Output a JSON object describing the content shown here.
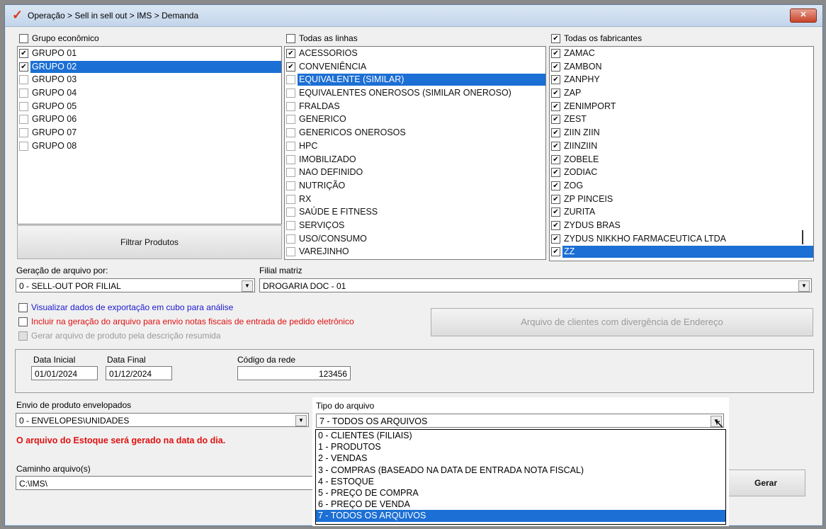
{
  "window": {
    "title": "Operação > Sell in sell out > IMS > Demanda",
    "close_label": "✕"
  },
  "grupo": {
    "header": "Grupo econômico",
    "header_checked": false,
    "items": [
      {
        "label": "GRUPO 01",
        "checked": true,
        "selected": false
      },
      {
        "label": "GRUPO 02",
        "checked": true,
        "selected": true
      },
      {
        "label": "GRUPO 03",
        "checked": false,
        "selected": false
      },
      {
        "label": "GRUPO 04",
        "checked": false,
        "selected": false
      },
      {
        "label": "GRUPO 05",
        "checked": false,
        "selected": false
      },
      {
        "label": "GRUPO 06",
        "checked": false,
        "selected": false
      },
      {
        "label": "GRUPO 07",
        "checked": false,
        "selected": false
      },
      {
        "label": "GRUPO 08",
        "checked": false,
        "selected": false
      }
    ],
    "filter_button": "Filtrar Produtos"
  },
  "linhas": {
    "header": "Todas as linhas",
    "header_checked": false,
    "items": [
      {
        "label": "ACESSORIOS",
        "checked": true,
        "selected": false
      },
      {
        "label": "CONVENIÊNCIA",
        "checked": true,
        "selected": false
      },
      {
        "label": "EQUIVALENTE (SIMILAR)",
        "checked": false,
        "selected": true
      },
      {
        "label": "EQUIVALENTES ONEROSOS (SIMILAR ONEROSO)",
        "checked": false,
        "selected": false
      },
      {
        "label": "FRALDAS",
        "checked": false,
        "selected": false
      },
      {
        "label": "GENERICO",
        "checked": false,
        "selected": false
      },
      {
        "label": "GENERICOS ONEROSOS",
        "checked": false,
        "selected": false
      },
      {
        "label": "HPC",
        "checked": false,
        "selected": false
      },
      {
        "label": "IMOBILIZADO",
        "checked": false,
        "selected": false
      },
      {
        "label": "NAO DEFINIDO",
        "checked": false,
        "selected": false
      },
      {
        "label": "NUTRIÇÃO",
        "checked": false,
        "selected": false
      },
      {
        "label": "RX",
        "checked": false,
        "selected": false
      },
      {
        "label": "SAÚDE E FITNESS",
        "checked": false,
        "selected": false
      },
      {
        "label": "SERVIÇOS",
        "checked": false,
        "selected": false
      },
      {
        "label": "USO/CONSUMO",
        "checked": false,
        "selected": false
      },
      {
        "label": "VAREJINHO",
        "checked": false,
        "selected": false
      }
    ]
  },
  "fabricantes": {
    "header": "Todas os fabricantes",
    "header_checked": true,
    "items": [
      {
        "label": "ZAMAC",
        "checked": true,
        "selected": false
      },
      {
        "label": "ZAMBON",
        "checked": true,
        "selected": false
      },
      {
        "label": "ZANPHY",
        "checked": true,
        "selected": false
      },
      {
        "label": "ZAP",
        "checked": true,
        "selected": false
      },
      {
        "label": "ZENIMPORT",
        "checked": true,
        "selected": false
      },
      {
        "label": "ZEST",
        "checked": true,
        "selected": false
      },
      {
        "label": "ZIIN ZIIN",
        "checked": true,
        "selected": false
      },
      {
        "label": "ZIINZIIN",
        "checked": true,
        "selected": false
      },
      {
        "label": "ZOBELE",
        "checked": true,
        "selected": false
      },
      {
        "label": "ZODIAC",
        "checked": true,
        "selected": false
      },
      {
        "label": "ZOG",
        "checked": true,
        "selected": false
      },
      {
        "label": "ZP PINCEIS",
        "checked": true,
        "selected": false
      },
      {
        "label": "ZURITA",
        "checked": true,
        "selected": false
      },
      {
        "label": "ZYDUS BRAS",
        "checked": true,
        "selected": false
      },
      {
        "label": "ZYDUS NIKKHO FARMACEUTICA LTDA",
        "checked": true,
        "selected": false
      },
      {
        "label": "ZZ",
        "checked": true,
        "selected": true
      }
    ]
  },
  "geracao": {
    "label": "Geração de arquivo por:",
    "value": "0 - SELL-OUT POR FILIAL"
  },
  "filial": {
    "label": "Filial matriz",
    "value": "DROGARIA DOC - 01"
  },
  "options": {
    "cubo": "Visualizar dados de exportação em cubo para análise",
    "cubo_color": "#1a1ad0",
    "notas": "Incluir na geração do arquivo para envio notas fiscais de entrada de pedido eletrônico",
    "notas_color": "#e01010",
    "descricao": "Gerar arquivo de produto pela descrição resumida",
    "descricao_color": "#9a9a9a"
  },
  "divergencia_button": "Arquivo de clientes com divergência de Endereço",
  "datas": {
    "inicial_label": "Data Inicial",
    "inicial_value": "01/01/2024",
    "final_label": "Data Final",
    "final_value": "01/12/2024",
    "rede_label": "Código da rede",
    "rede_value": "123456"
  },
  "envio": {
    "label": "Envio de produto envelopados",
    "value": "0 - ENVELOPES\\UNIDADES"
  },
  "warning": "O arquivo do Estoque será gerado na data do dia.",
  "warning_color": "#e01010",
  "caminho": {
    "label": "Caminho arquivo(s)",
    "value": "C:\\IMS\\"
  },
  "gerar_button": "Gerar",
  "tipo": {
    "label": "Tipo do arquivo",
    "value": "7 - TODOS OS ARQUIVOS",
    "options": [
      {
        "label": "0 - CLIENTES (FILIAIS)",
        "selected": false
      },
      {
        "label": "1 - PRODUTOS",
        "selected": false
      },
      {
        "label": "2 - VENDAS",
        "selected": false
      },
      {
        "label": "3 - COMPRAS (BASEADO NA DATA DE ENTRADA NOTA FISCAL)",
        "selected": false
      },
      {
        "label": "4 - ESTOQUE",
        "selected": false
      },
      {
        "label": "5 - PREÇO DE COMPRA",
        "selected": false
      },
      {
        "label": "6 - PREÇO DE VENDA",
        "selected": false
      },
      {
        "label": "7 - TODOS OS ARQUIVOS",
        "selected": true
      }
    ]
  },
  "accent_color": "#1c6fd4"
}
